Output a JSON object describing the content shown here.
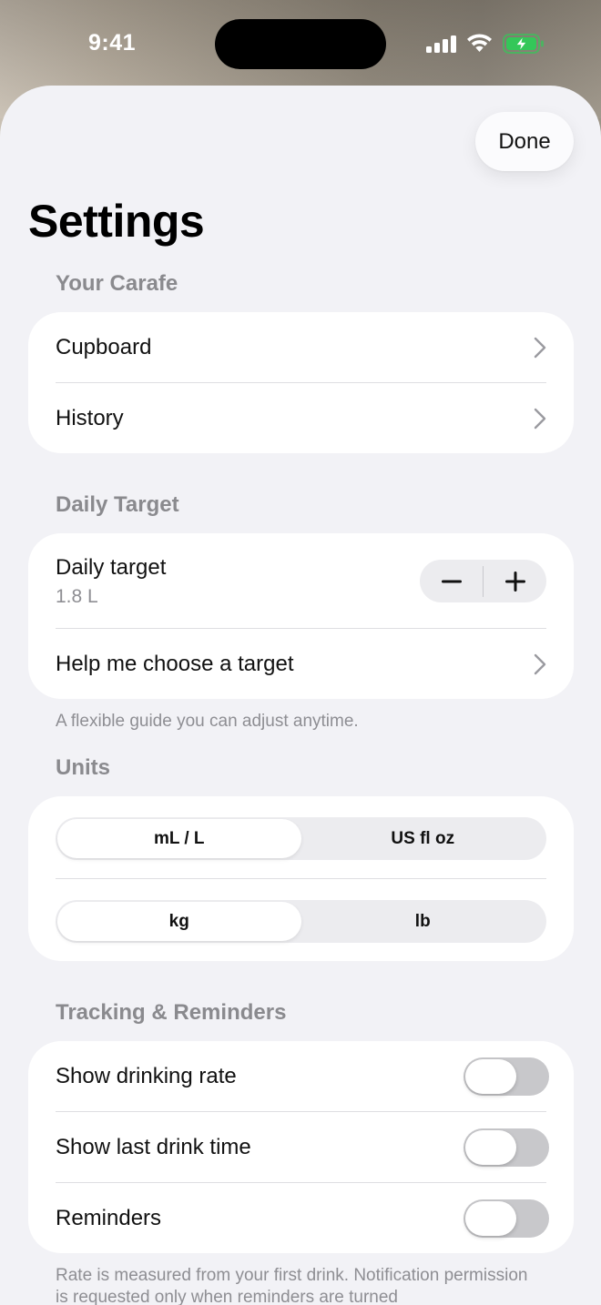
{
  "status_bar": {
    "time": "9:41"
  },
  "toolbar": {
    "done_label": "Done"
  },
  "page": {
    "title": "Settings"
  },
  "sections": {
    "carafe": {
      "header": "Your Carafe",
      "items": [
        {
          "label": "Cupboard"
        },
        {
          "label": "History"
        }
      ]
    },
    "daily_target": {
      "header": "Daily Target",
      "target_label": "Daily target",
      "target_value": "1.8 L",
      "decrement_icon": "minus-icon",
      "increment_icon": "plus-icon",
      "help_label": "Help me choose a target",
      "footer": "A flexible guide you can adjust anytime."
    },
    "units": {
      "header": "Units",
      "volume": {
        "options": [
          "mL / L",
          "US fl oz"
        ],
        "selected": "mL / L"
      },
      "weight": {
        "options": [
          "kg",
          "lb"
        ],
        "selected": "kg"
      }
    },
    "tracking": {
      "header": "Tracking & Reminders",
      "toggles": [
        {
          "label": "Show drinking rate",
          "on": false
        },
        {
          "label": "Show last drink time",
          "on": false
        },
        {
          "label": "Reminders",
          "on": false
        }
      ],
      "footer": "Rate is measured from your first drink. Notification permission is requested only when reminders are turned"
    }
  },
  "colors": {
    "sheet_background": "#f2f2f6",
    "card_background": "#ffffff",
    "secondary_text": "#8a8a8e",
    "battery_charging": "#34c759"
  }
}
